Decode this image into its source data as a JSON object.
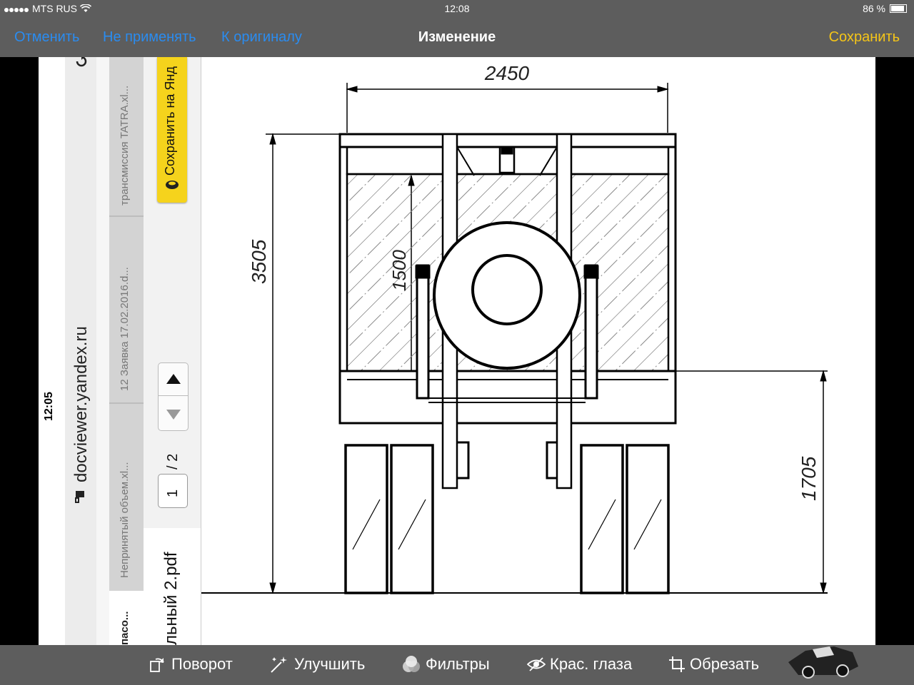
{
  "status_bar": {
    "carrier": "MTS RUS",
    "time": "12:08",
    "battery": "86 %"
  },
  "nav": {
    "cancel": "Отменить",
    "dont_apply": "Не применять",
    "to_original": "К оригиналу",
    "title": "Изменение",
    "save": "Сохранить"
  },
  "browser": {
    "time": "12:05",
    "address": "docviewer.yandex.ru",
    "tabs": [
      "трансмиссия TATRA.xl...",
      "12 Заявка 17.02.2016.d...",
      "Непринятый объем.xl...",
      "пасо..."
    ],
    "save_to_yandex": "Сохранить на Янд",
    "page_current": "1",
    "page_total": "/ 2",
    "doc_name": "льный 2.pdf"
  },
  "drawing": {
    "dim_width": "2450",
    "dim_height": "3505",
    "dim_tank_height": "1500",
    "dim_frame_height": "1705"
  },
  "toolbar": {
    "rotate": "Поворот",
    "enhance": "Улучшить",
    "filters": "Фильтры",
    "red_eye": "Крас. глаза",
    "crop": "Обрезать"
  }
}
